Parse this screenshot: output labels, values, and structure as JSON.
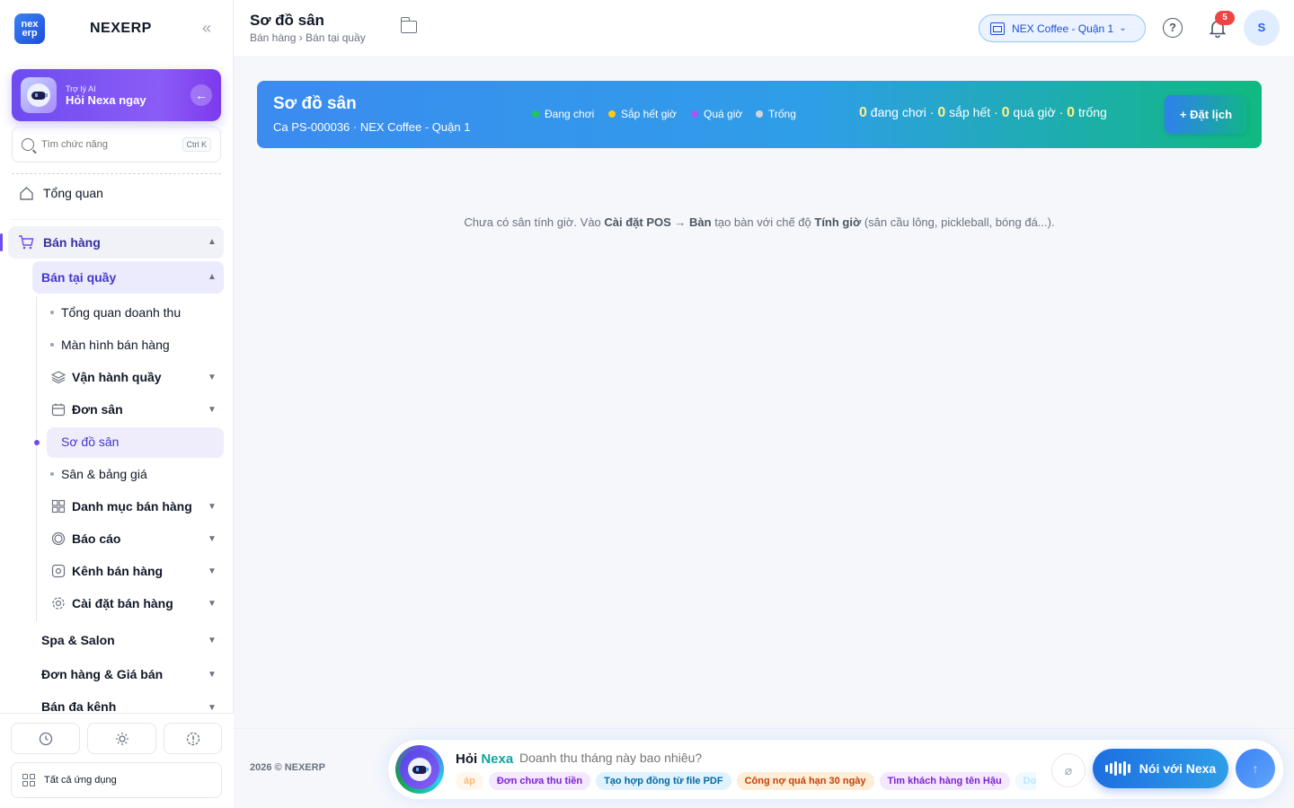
{
  "sidebar": {
    "brand": "NEXERP",
    "logo_line1": "nex",
    "logo_line2": "erp",
    "ai_card": {
      "small": "Trợ lý AI",
      "big": "Hỏi Nexa ngay"
    },
    "search": {
      "placeholder": "Tìm chức năng",
      "shortcut": "Ctrl K"
    },
    "overview": "Tổng quan",
    "group": "Bán hàng",
    "subgroup": "Bán tại quầy",
    "items": [
      "Tổng quan doanh thu",
      "Màn hình bán hàng",
      "Vận hành quầy",
      "Đơn sân",
      "Sơ đồ sân",
      "Sân & bảng giá",
      "Danh mục bán hàng",
      "Báo cáo",
      "Kênh bán hàng",
      "Cài đặt bán hàng"
    ],
    "groups": [
      "Spa & Salon",
      "Đơn hàng & Giá bán",
      "Bán đa kênh"
    ],
    "all_apps": "Tất cả ứng dụng"
  },
  "header": {
    "title": "Sơ đồ sân",
    "breadcrumb": "Bán hàng › Bán tại quầy",
    "branch": "NEX Coffee - Quận 1",
    "notifications": "5",
    "avatar": "S"
  },
  "banner": {
    "title": "Sơ đồ sân",
    "subtitle": "Ca PS-000036 · NEX Coffee - Quận 1",
    "legend": [
      {
        "label": "Đang chơi",
        "color": "#22c55e"
      },
      {
        "label": "Sắp hết giờ",
        "color": "#facc15"
      },
      {
        "label": "Quá giờ",
        "color": "#a855f7"
      },
      {
        "label": "Trống",
        "color": "#d1d5db"
      }
    ],
    "summary": {
      "playing_count": "0",
      "playing_label": "đang chơi",
      "ending_count": "0",
      "ending_label": "sắp hết",
      "overdue_count": "0",
      "overdue_label": "quá giờ",
      "empty_count": "0",
      "empty_label": "trống"
    },
    "book_button": "+ Đặt lịch"
  },
  "empty_message": {
    "part1": "Chưa có sân tính giờ. Vào ",
    "bold1": "Cài đặt POS",
    "arrow": " → ",
    "bold2": "Bàn",
    "part2": " tạo bàn với chế độ ",
    "bold3": "Tính giờ",
    "part3": " (sân cầu lông, pickleball, bóng đá...)."
  },
  "footer": {
    "copyright": "2026 © NEXERP",
    "ask_prefix": "Hỏi",
    "ask_name": "Nexa",
    "ask_placeholder": "Doanh thu tháng này bao nhiêu?",
    "chips": [
      {
        "label": "áp",
        "bg": "#fff7ed",
        "color": "#fdba74"
      },
      {
        "label": "Đơn chưa thu tiền",
        "bg": "#f3e8ff",
        "color": "#7e22ce"
      },
      {
        "label": "Tạo hợp đồng từ file PDF",
        "bg": "#e0f2fe",
        "color": "#0369a1"
      },
      {
        "label": "Công nợ quá hạn 30 ngày",
        "bg": "#ffedd5",
        "color": "#c2410c"
      },
      {
        "label": "Tìm khách hàng tên Hậu",
        "bg": "#f3e8ff",
        "color": "#7e22ce"
      },
      {
        "label": "Do",
        "bg": "#f0f9ff",
        "color": "#bae6fd"
      }
    ],
    "voice_button": "Nói với Nexa"
  }
}
